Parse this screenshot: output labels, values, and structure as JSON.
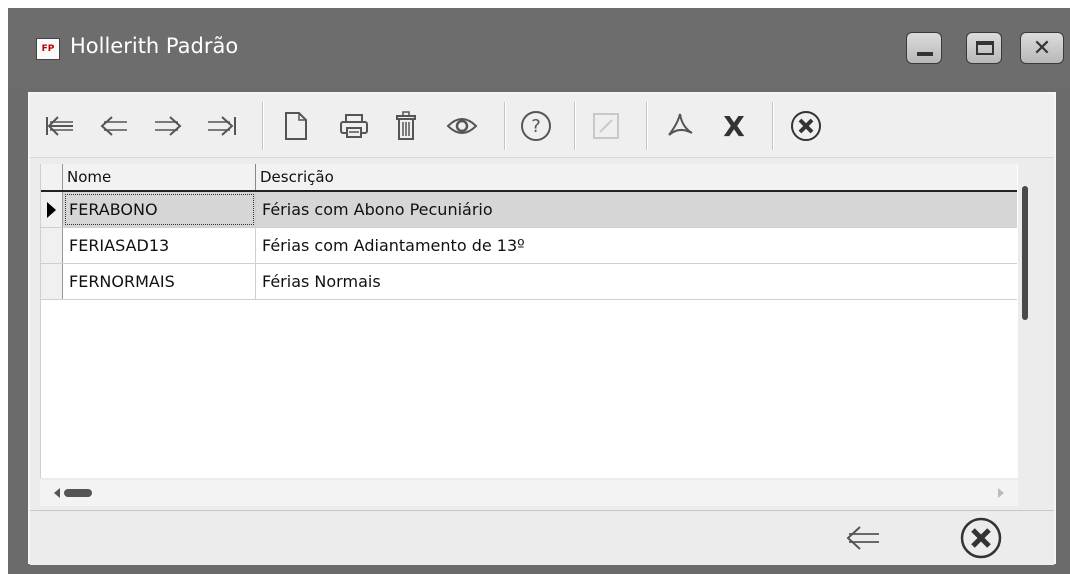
{
  "window": {
    "title": "Hollerith Padrão",
    "app_icon_text": "FP",
    "controls": [
      "minimize-icon",
      "maximize-icon",
      "close-icon"
    ]
  },
  "toolbar": {
    "buttons": [
      {
        "name": "first-record",
        "icon": "first-arrow-icon",
        "glyph": "⇤"
      },
      {
        "name": "previous-record",
        "icon": "left-arrow-icon",
        "glyph": "⇐"
      },
      {
        "name": "next-record",
        "icon": "right-arrow-icon",
        "glyph": "⇒"
      },
      {
        "name": "last-record",
        "icon": "last-arrow-icon",
        "glyph": "⇥"
      },
      {
        "name": "new-record",
        "icon": "new-document-icon",
        "glyph": "🗋"
      },
      {
        "name": "print",
        "icon": "printer-icon",
        "glyph": "🖶"
      },
      {
        "name": "delete",
        "icon": "trash-icon",
        "glyph": "🗑"
      },
      {
        "name": "view",
        "icon": "eye-icon",
        "glyph": "👁"
      },
      {
        "name": "help",
        "icon": "help-icon",
        "glyph": "?"
      },
      {
        "name": "edit",
        "icon": "edit-icon",
        "glyph": "✎"
      },
      {
        "name": "export-pdf",
        "icon": "pdf-icon",
        "glyph": "⅄"
      },
      {
        "name": "export-excel",
        "icon": "excel-icon",
        "glyph": "X"
      },
      {
        "name": "cancel",
        "icon": "cancel-icon",
        "glyph": "✖"
      }
    ]
  },
  "grid": {
    "columns": [
      "Nome",
      "Descrição"
    ],
    "rows": [
      {
        "nome": "FERABONO",
        "descricao": "Férias com Abono Pecuniário",
        "selected": true
      },
      {
        "nome": "FERIASAD13",
        "descricao": "Férias com Adiantamento de 13º",
        "selected": false
      },
      {
        "nome": "FERNORMAIS",
        "descricao": "Férias Normais",
        "selected": false
      }
    ]
  },
  "footer": {
    "buttons": [
      {
        "name": "back",
        "icon": "back-arrow-icon",
        "glyph": "⇐"
      },
      {
        "name": "close",
        "icon": "cancel-icon",
        "glyph": "✖"
      }
    ]
  }
}
